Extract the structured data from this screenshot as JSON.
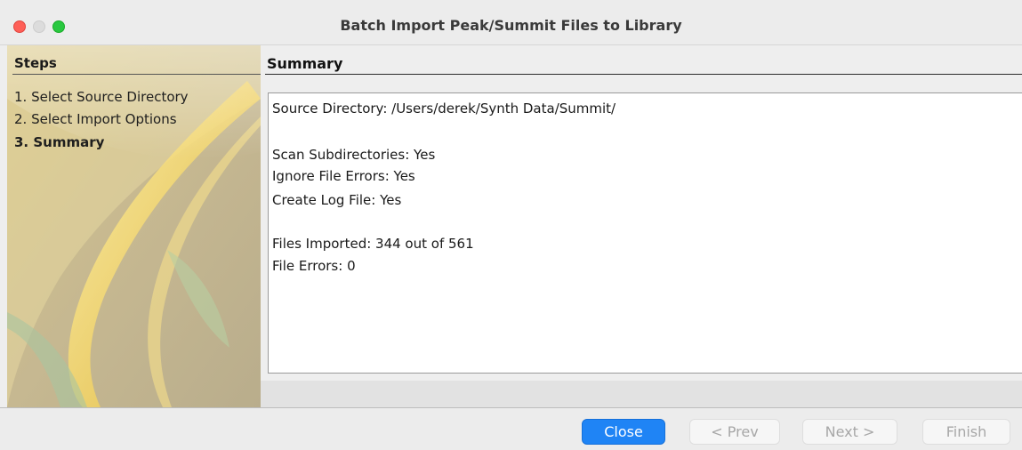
{
  "window": {
    "title": "Batch Import Peak/Summit Files to Library"
  },
  "steps": {
    "header": "Steps",
    "items": [
      "1. Select Source Directory",
      "2. Select Import Options",
      "3. Summary"
    ],
    "current_index": 2
  },
  "summary": {
    "header": "Summary",
    "source_directory": "Source Directory: /Users/derek/Synth Data/Summit/",
    "scan_subdirectories": "Scan Subdirectories: Yes",
    "ignore_file_errors": "Ignore File Errors: Yes",
    "create_log_file": "Create Log File: Yes",
    "files_imported": "Files Imported: 344 out of 561",
    "file_errors": "File Errors: 0"
  },
  "buttons": {
    "close": "Close",
    "prev": "< Prev",
    "next": "Next >",
    "finish": "Finish"
  },
  "colors": {
    "primary_button": "#1f84f5",
    "steps_panel": "#c9b98a"
  }
}
